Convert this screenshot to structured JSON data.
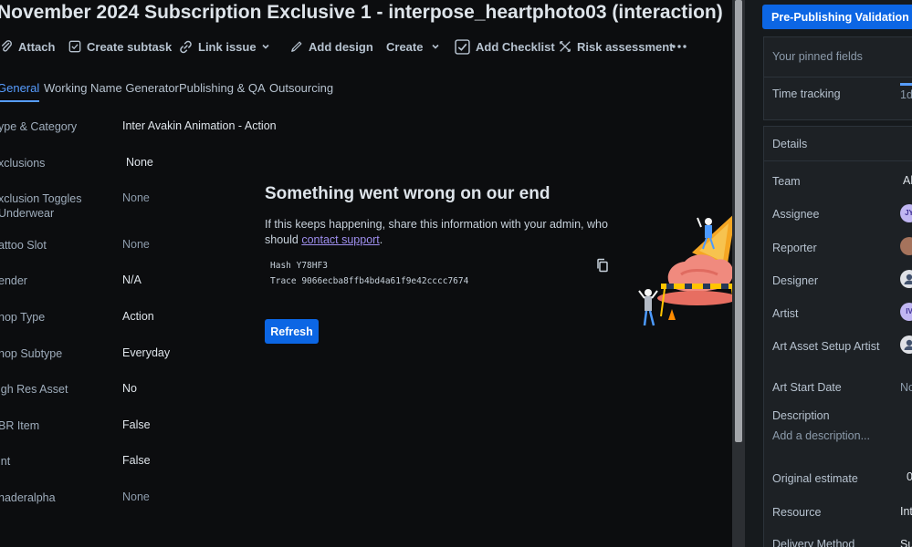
{
  "issue": {
    "title": "November 2024 Subscription Exclusive 1 - interpose_heartphoto03 (interaction)"
  },
  "toolbar": {
    "attach": "Attach",
    "create_subtask": "Create subtask",
    "link_issue": "Link issue",
    "add_design": "Add design",
    "create": "Create",
    "add_checklist": "Add Checklist",
    "risk_assessment": "Risk assessment"
  },
  "tabs": [
    {
      "label": "General",
      "active": true
    },
    {
      "label": "Working Name Generator",
      "active": false
    },
    {
      "label": "Publishing & QA",
      "active": false
    },
    {
      "label": "Outsourcing",
      "active": false
    }
  ],
  "fields": [
    {
      "label": "ype & Category",
      "value": "Inter Avakin Animation - Action"
    },
    {
      "label": "xclusions",
      "value": "None"
    },
    {
      "label": "xclusion Toggles Underwear",
      "value": "None"
    },
    {
      "label": "attoo Slot",
      "value": "None"
    },
    {
      "label": "ender",
      "value": "N/A"
    },
    {
      "label": "hop Type",
      "value": "Action"
    },
    {
      "label": "hop Subtype",
      "value": "Everyday"
    },
    {
      "label": "igh Res Asset",
      "value": "No"
    },
    {
      "label": "BR Item",
      "value": "False"
    },
    {
      "label": "int",
      "value": "False"
    },
    {
      "label": "haderalpha",
      "value": "None"
    }
  ],
  "error": {
    "title": "Something went wrong on our end",
    "message_before": "If this keeps happening, share this information with your admin, who should ",
    "link": "contact support",
    "message_after": ".",
    "hash": "Hash Y78HF3",
    "trace": "Trace 9066ecba8ffb4bd4a61f9e42cccc7674",
    "refresh": "Refresh"
  },
  "sidebar": {
    "status_button": "Pre-Publishing Validation",
    "pinned": "Your pinned fields",
    "time_tracking": "Time tracking",
    "time_tracking_value": "1d",
    "details": "Details",
    "team": "Team",
    "team_value": "Al",
    "assignee": "Assignee",
    "assignee_initials": "JY",
    "reporter": "Reporter",
    "designer": "Designer",
    "artist": "Artist",
    "artist_initials": "IV",
    "art_asset_setup_artist": "Art Asset Setup Artist",
    "art_start_date": "Art Start Date",
    "art_start_date_value": "No",
    "description": "Description",
    "description_placeholder": "Add a description...",
    "original_estimate": "Original estimate",
    "original_estimate_value": "0",
    "resource": "Resource",
    "resource_value": "Int",
    "delivery_method": "Delivery Method",
    "delivery_method_value": "Su"
  },
  "colors": {
    "accent": "#0c66e4",
    "link": "#579dff",
    "background": "#0c0d0f"
  }
}
